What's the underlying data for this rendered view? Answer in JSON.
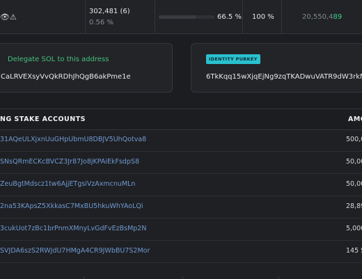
{
  "validator_row": {
    "icons": [
      "eye-icon",
      "warning-icon"
    ],
    "icon_glyphs": "👁⚠",
    "stake_line": "302,481  (6)",
    "stake_percent": "0.56 %",
    "cumulative_bar_fraction": 0.66,
    "cumulative_percent": "66.5 %",
    "uptime_percent": "100 %",
    "credits_prefix": "20,550,4",
    "credits_highlight": "89"
  },
  "delegate_card": {
    "label": "Delegate SOL to this address",
    "address": "CaLRVEXsyVvQkRDhJhQgB6akPme1e"
  },
  "identity_card": {
    "badge": "IDENTITY PUBKEY",
    "pubkey": "6TkKqq15wXjqEjNg9zqTKADwuVATR9dW3rkNnsY"
  },
  "stake_accounts": {
    "title": "NG STAKE ACCOUNTS",
    "amount_header": "AMC",
    "rows": [
      {
        "address": "31AQeULXjxnUuGHpUbmU8DBJV5UhQotva8",
        "amount": "500,0"
      },
      {
        "address": "SNsQRmECKcBVCZ3Jr87Jo8jKPAiEkFsdpS8",
        "amount": "50,00"
      },
      {
        "address": "ZeuBgtMdscz1tw6AjjETgsiVzAxmcnuMLn",
        "amount": "50,00"
      },
      {
        "address": "2na53KApsZ5XkkasC7MxBU5hkuWhYAoLQi",
        "amount": "28,89"
      },
      {
        "address": "3cukUot7zBc1brPnmXMnyLvGdFvEzBsMp2N",
        "amount": "5,000"
      },
      {
        "address": "SVJDA6szS2RWJdU7HMgA4CR9JWbBU7S2Mor",
        "amount": "145 S"
      }
    ]
  }
}
